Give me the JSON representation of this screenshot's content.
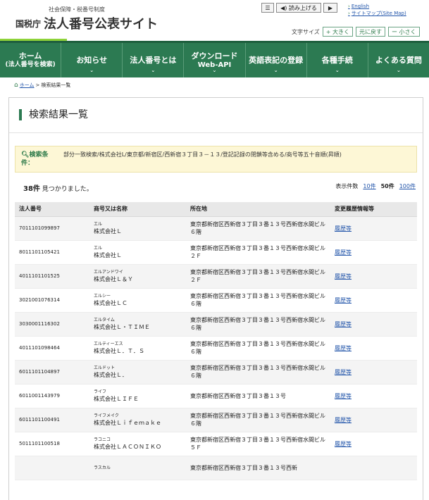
{
  "header": {
    "agency_small": "社会保障・税番号制度",
    "agency": "国税庁",
    "site_title": "法人番号公表サイト",
    "read_aloud": "読み上げる",
    "links": {
      "english": "English",
      "sitemap": "サイトマップ(Site Map)"
    },
    "font_size_label": "文字サイズ",
    "font_larger": "+ 大きく",
    "font_reset": "元に戻す",
    "font_smaller": "ー 小さく"
  },
  "nav": {
    "home": "ホーム",
    "home_sub": "(法人番号を検索)",
    "news": "お知らせ",
    "about": "法人番号とは",
    "download": "ダウンロード",
    "download_sub": "Web-API",
    "english_reg": "英語表記の登録",
    "procedures": "各種手続",
    "faq": "よくある質問"
  },
  "breadcrumb": {
    "home": "ホーム",
    "sep": ">",
    "current": "検索結果一覧"
  },
  "page_title": "検索結果一覧",
  "conditions": {
    "label": "検索条件：",
    "text": "部分一致検索/株式会社L/東京都/新宿区/西新宿３丁目３－１３/登記記録の閉鎖等含める/商号等五十音順(昇順)"
  },
  "result_count": {
    "number": "38件",
    "suffix": " 見つかりました。"
  },
  "pagination": {
    "label": "表示件数",
    "opt10": "10件",
    "opt50": "50件",
    "opt100": "100件"
  },
  "table": {
    "headers": [
      "法人番号",
      "商号又は名称",
      "所在地",
      "変更履歴情報等"
    ],
    "rows": [
      {
        "num": "7011101099897",
        "kana": "エル",
        "name": "株式会社Ｌ",
        "addr": "東京都新宿区西新宿３丁目３番１３号西新宿水間ビル６階",
        "hist": "履歴等"
      },
      {
        "num": "8011101105421",
        "kana": "エル",
        "name": "株式会社Ｌ",
        "addr": "東京都新宿区西新宿３丁目３番１３号西新宿水間ビル２Ｆ",
        "hist": "履歴等"
      },
      {
        "num": "4011101101525",
        "kana": "エルアンドワイ",
        "name": "株式会社Ｌ＆Ｙ",
        "addr": "東京都新宿区西新宿３丁目３番１３号西新宿水間ビル２Ｆ",
        "hist": "履歴等"
      },
      {
        "num": "3021001076314",
        "kana": "エルシー",
        "name": "株式会社ＬＣ",
        "addr": "東京都新宿区西新宿３丁目３番１３号西新宿水間ビル６階",
        "hist": "履歴等"
      },
      {
        "num": "3030001116302",
        "kana": "エルタイム",
        "name": "株式会社Ｌ・ＴＩＭＥ",
        "addr": "東京都新宿区西新宿３丁目３番１３号西新宿水間ビル６階",
        "hist": "履歴等"
      },
      {
        "num": "4011101098464",
        "kana": "エルティーエス",
        "name": "株式会社Ｌ．Ｔ．Ｓ",
        "addr": "東京都新宿区西新宿３丁目３番１３号西新宿水間ビル６階",
        "hist": "履歴等"
      },
      {
        "num": "6011101104897",
        "kana": "エルドット",
        "name": "株式会社Ｌ．",
        "addr": "東京都新宿区西新宿３丁目３番１３号西新宿水間ビル６階",
        "hist": "履歴等"
      },
      {
        "num": "6011001143979",
        "kana": "ライフ",
        "name": "株式会社ＬＩＦＥ",
        "addr": "東京都新宿区西新宿３丁目３番１３号",
        "hist": "履歴等"
      },
      {
        "num": "6011101100491",
        "kana": "ライフメイク",
        "name": "株式会社Ｌｉｆｅｍａｋｅ",
        "addr": "東京都新宿区西新宿３丁目３番１３号西新宿水間ビル６階",
        "hist": "履歴等"
      },
      {
        "num": "5011101100518",
        "kana": "ラコニコ",
        "name": "株式会社ＬＡＣＯＮＩＫＯ",
        "addr": "東京都新宿区西新宿３丁目３番１３号西新宿水間ビル５Ｆ",
        "hist": "履歴等"
      },
      {
        "num": "",
        "kana": "ラスカル",
        "name": "",
        "addr": "東京都新宿区西新宿３丁目３番１３号西新",
        "hist": ""
      }
    ]
  }
}
